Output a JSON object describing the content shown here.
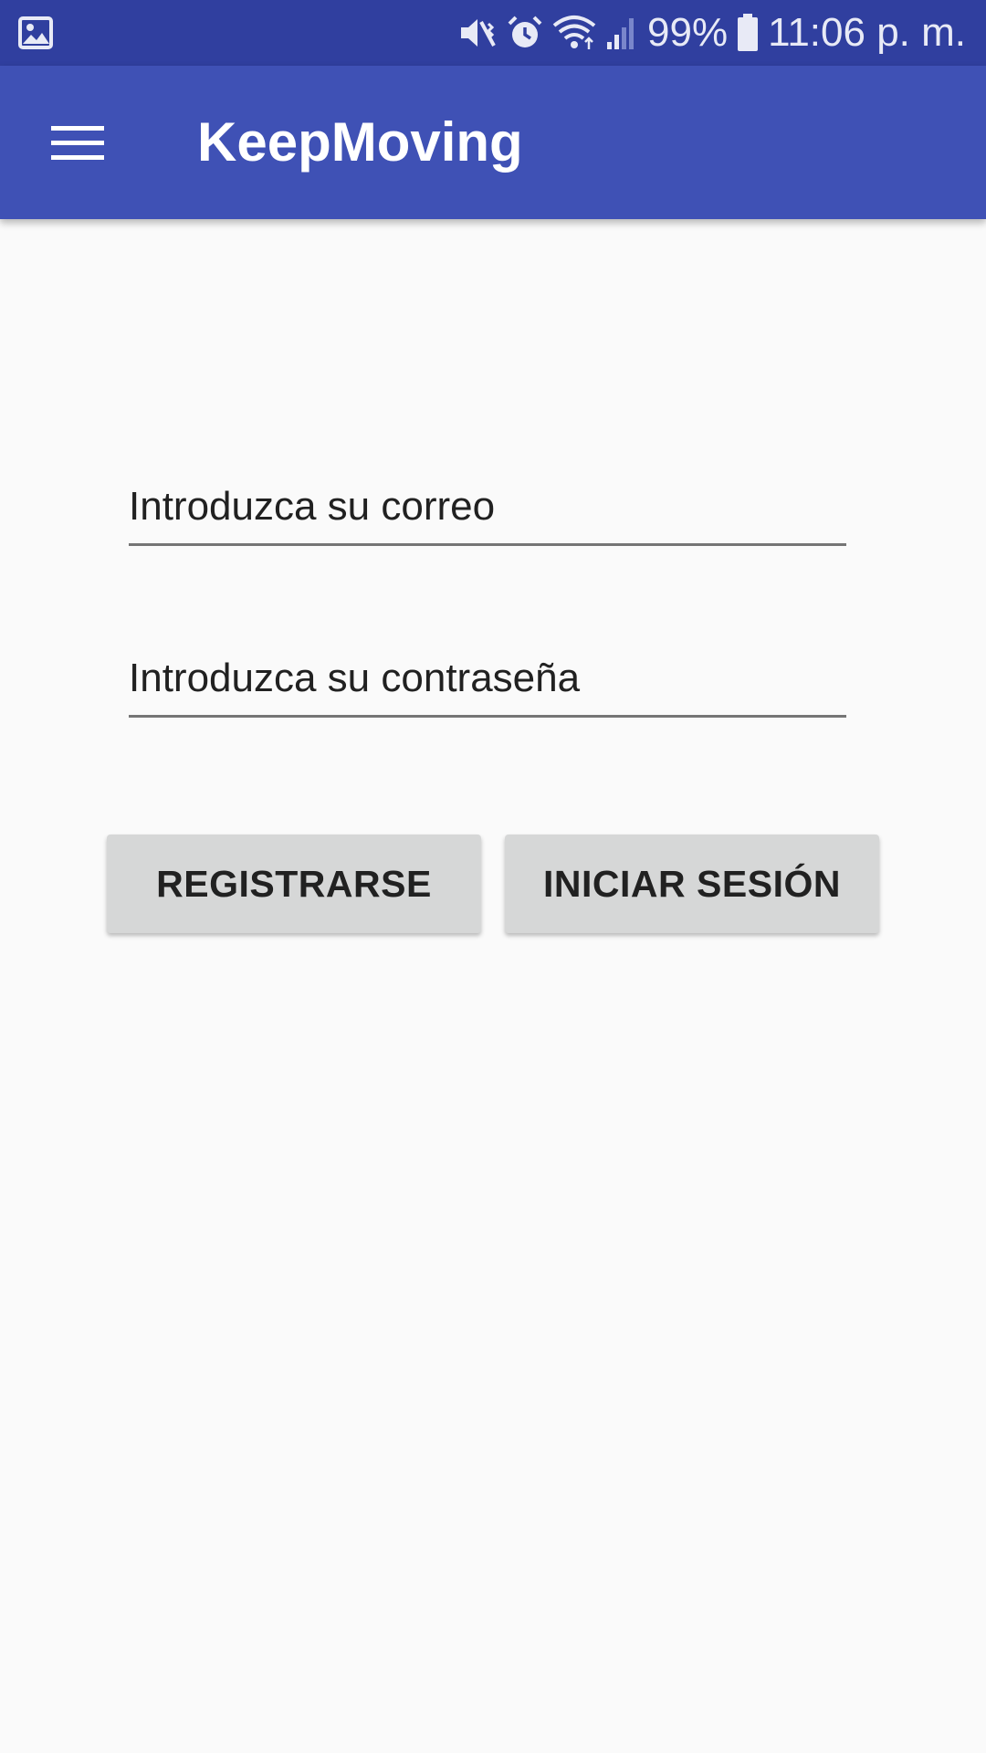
{
  "status_bar": {
    "battery_percent": "99%",
    "time": "11:06 p. m.",
    "icons": [
      "gallery-icon",
      "vibrate-mute-icon",
      "alarm-icon",
      "wifi-icon",
      "signal-icon",
      "battery-icon"
    ],
    "background_color": "#303f9f"
  },
  "app_bar": {
    "title": "KeepMoving",
    "menu_icon": "menu-icon",
    "background_color": "#3f51b5"
  },
  "form": {
    "email_placeholder": "Introduzca su correo",
    "email_value": "",
    "password_placeholder": "Introduzca su contraseña",
    "password_value": ""
  },
  "buttons": {
    "register_label": "REGISTRARSE",
    "login_label": "INICIAR SESIÓN"
  }
}
